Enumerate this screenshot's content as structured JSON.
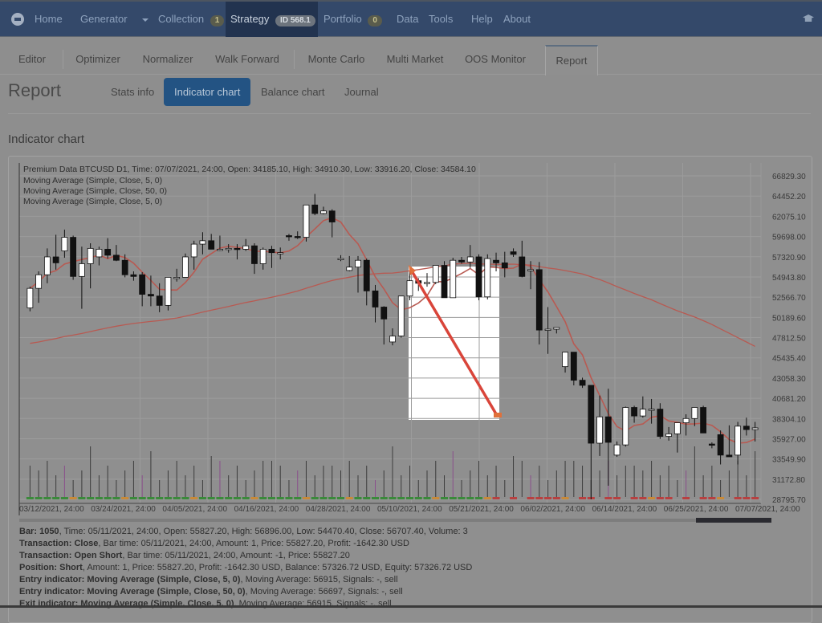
{
  "navbar": {
    "items": [
      {
        "label": "Home"
      },
      {
        "label": "Generator"
      },
      {
        "label": "Collection",
        "badge": "1"
      },
      {
        "label": "Strategy",
        "badge": "ID 568.1"
      },
      {
        "label": "Portfolio",
        "badge": "0"
      },
      {
        "label": "Data"
      },
      {
        "label": "Tools"
      },
      {
        "label": "Help"
      },
      {
        "label": "About"
      }
    ]
  },
  "tabs": [
    {
      "label": "Editor"
    },
    {
      "label": "Optimizer"
    },
    {
      "label": "Normalizer"
    },
    {
      "label": "Walk Forward"
    },
    {
      "label": "Monte Carlo"
    },
    {
      "label": "Multi Market"
    },
    {
      "label": "OOS Monitor"
    },
    {
      "label": "Report"
    }
  ],
  "report": {
    "title": "Report",
    "subtabs": [
      {
        "label": "Stats info"
      },
      {
        "label": "Indicator chart"
      },
      {
        "label": "Balance chart"
      },
      {
        "label": "Journal"
      }
    ],
    "section_title": "Indicator chart"
  },
  "chart_data": {
    "type": "candlestick",
    "title": "Premium Data BTCUSD D1, Time: 07/07/2021, 24:00, Open: 34185.10, High: 34910.30, Low: 33916.20, Close: 34584.10",
    "legend": [
      "Moving Average (Simple, Close, 5, 0)",
      "Moving Average (Simple, Close, 50, 0)",
      "Moving Average (Simple, Close, 5, 0)"
    ],
    "y_ticks": [
      "66829.30",
      "64452.20",
      "62075.10",
      "59698.00",
      "57320.90",
      "54943.80",
      "52566.70",
      "50189.60",
      "47812.50",
      "45435.40",
      "43058.30",
      "40681.20",
      "38304.10",
      "35927.00",
      "33549.90",
      "31172.80",
      "28795.70"
    ],
    "ylim": [
      28795.7,
      66829.3
    ],
    "x_ticks": [
      "03/12/2021, 24:00",
      "03/24/2021, 24:00",
      "04/05/2021, 24:00",
      "04/16/2021, 24:00",
      "04/28/2021, 24:00",
      "05/10/2021, 24:00",
      "05/21/2021, 24:00",
      "06/02/2021, 24:00",
      "06/14/2021, 24:00",
      "06/25/2021, 24:00",
      "07/07/2021, 24:00"
    ],
    "grid": true,
    "candles": [
      [
        51300,
        53800,
        50900,
        53600
      ],
      [
        53600,
        55600,
        51900,
        55200
      ],
      [
        55200,
        58300,
        54200,
        57300
      ],
      [
        57300,
        59900,
        55800,
        56600
      ],
      [
        58000,
        60500,
        57200,
        59600
      ],
      [
        59600,
        59800,
        54600,
        55000
      ],
      [
        55000,
        58500,
        51200,
        56500
      ],
      [
        56500,
        58900,
        53600,
        58300
      ],
      [
        57300,
        58500,
        56300,
        58200
      ],
      [
        58200,
        59500,
        57100,
        57500
      ],
      [
        57500,
        58700,
        56800,
        56900
      ],
      [
        56900,
        57600,
        54900,
        55200
      ],
      [
        55200,
        55600,
        54500,
        55000
      ],
      [
        55200,
        55500,
        51500,
        52900
      ],
      [
        52900,
        55100,
        51500,
        52700
      ],
      [
        52700,
        54200,
        50800,
        51600
      ],
      [
        51600,
        54500,
        51000,
        54900
      ],
      [
        54900,
        55900,
        54400,
        54900
      ],
      [
        54900,
        57700,
        55000,
        57300
      ],
      [
        57300,
        59200,
        55800,
        58800
      ],
      [
        58800,
        60200,
        57600,
        59200
      ],
      [
        59200,
        60000,
        58200,
        58200
      ],
      [
        58200,
        59800,
        58000,
        58200
      ],
      [
        58200,
        58800,
        57800,
        58300
      ],
      [
        58300,
        58800,
        57000,
        58200
      ],
      [
        58200,
        59400,
        58000,
        58600
      ],
      [
        58600,
        58900,
        55300,
        56500
      ],
      [
        56500,
        58400,
        55800,
        58200
      ],
      [
        58200,
        58600,
        56000,
        57800
      ],
      [
        57800,
        58400,
        57000,
        57800
      ],
      [
        59800,
        60000,
        59200,
        59700
      ],
      [
        59700,
        60300,
        59400,
        59600
      ],
      [
        59600,
        63300,
        59100,
        63400
      ],
      [
        63400,
        64700,
        62200,
        62400
      ],
      [
        62400,
        63200,
        62300,
        62700
      ],
      [
        62700,
        62900,
        59600,
        61400
      ],
      [
        57100,
        57500,
        56800,
        57100
      ],
      [
        55700,
        57400,
        55600,
        56100
      ],
      [
        56100,
        57400,
        53100,
        56900
      ],
      [
        56900,
        57100,
        51600,
        53300
      ],
      [
        53300,
        54000,
        49600,
        51400
      ],
      [
        51400,
        51500,
        47000,
        50000
      ],
      [
        47300,
        48900,
        46900,
        48000
      ],
      [
        48000,
        52500,
        47800,
        52700
      ],
      [
        52700,
        55600,
        52200,
        54500
      ],
      [
        54500,
        54800,
        53300,
        54200
      ],
      [
        54200,
        55400,
        53800,
        54300
      ],
      [
        54300,
        56300,
        54100,
        56300
      ],
      [
        56300,
        56800,
        54500,
        52500
      ],
      [
        52500,
        57200,
        52600,
        56900
      ],
      [
        56900,
        57300,
        56500,
        56700
      ],
      [
        56700,
        58700,
        56000,
        57300
      ],
      [
        57300,
        57600,
        52200,
        52600
      ],
      [
        52600,
        57600,
        52300,
        57100
      ],
      [
        56900,
        57800,
        55600,
        56600
      ],
      [
        56600,
        57900,
        54900,
        56000
      ],
      [
        57900,
        58300,
        57300,
        57600
      ],
      [
        57300,
        59200,
        54900,
        55000
      ],
      [
        55800,
        56800,
        53500,
        55800
      ],
      [
        55800,
        56700,
        47000,
        48700
      ],
      [
        48700,
        51400,
        45900,
        48800
      ],
      [
        48800,
        49000,
        48300,
        49000
      ],
      [
        44400,
        46000,
        43700,
        46100
      ],
      [
        46100,
        46000,
        42200,
        42800
      ],
      [
        42800,
        43100,
        41900,
        42200
      ],
      [
        42200,
        42200,
        28800,
        35400
      ],
      [
        35400,
        41000,
        33900,
        38500
      ],
      [
        38500,
        41800,
        30400,
        35500
      ],
      [
        34000,
        35600,
        33800,
        35200
      ],
      [
        35200,
        39700,
        35000,
        39600
      ],
      [
        39600,
        39800,
        37800,
        38600
      ],
      [
        38600,
        40900,
        38400,
        39400
      ],
      [
        39400,
        40600,
        37700,
        39400
      ],
      [
        39400,
        40100,
        35900,
        36200
      ],
      [
        36200,
        37300,
        35700,
        36500
      ],
      [
        36500,
        36900,
        34300,
        37800
      ],
      [
        37800,
        38800,
        36300,
        38300
      ],
      [
        38300,
        39600,
        37400,
        39600
      ],
      [
        39600,
        39800,
        36600,
        36600
      ],
      [
        35300,
        35500,
        34800,
        35200
      ],
      [
        36400,
        36900,
        32900,
        34000
      ],
      [
        34000,
        37500,
        33900,
        33800
      ],
      [
        34000,
        37900,
        32900,
        37400
      ],
      [
        37400,
        38400,
        36300,
        37000
      ],
      [
        37000,
        37900,
        35600,
        37200
      ]
    ]
  },
  "info": {
    "bar": {
      "label": "Bar:",
      "value": "1050",
      "rest": ", Time: 05/11/2021, 24:00, Open: 55827.20, High: 56896.00, Low: 54470.40, Close: 56707.40, Volume: 3"
    },
    "tx_close": {
      "label": "Transaction: Close",
      "rest": ", Bar time: 05/11/2021, 24:00, Amount: 1, Price: 55827.20, Profit: -1642.30 USD"
    },
    "tx_open": {
      "label": "Transaction: Open Short",
      "rest": ", Bar time: 05/11/2021, 24:00, Amount: -1, Price: 55827.20"
    },
    "position": {
      "label": "Position: Short",
      "rest": ", Amount: 1, Price: 55827.20, Profit: -1642.30 USD, Balance: 57326.72 USD, Equity: 57326.72 USD"
    },
    "entry1": {
      "label": "Entry indicator: Moving Average (Simple, Close, 5, 0)",
      "rest": ", Moving Average: 56915, Signals: -, sell"
    },
    "entry2": {
      "label": "Entry indicator: Moving Average (Simple, Close, 50, 0)",
      "rest": ", Moving Average: 56697, Signals: -, sell"
    },
    "exit1": {
      "label": "Exit indicator: Moving Average (Simple, Close, 5, 0)",
      "rest": ", Moving Average: 56915, Signals: -, sell"
    }
  }
}
